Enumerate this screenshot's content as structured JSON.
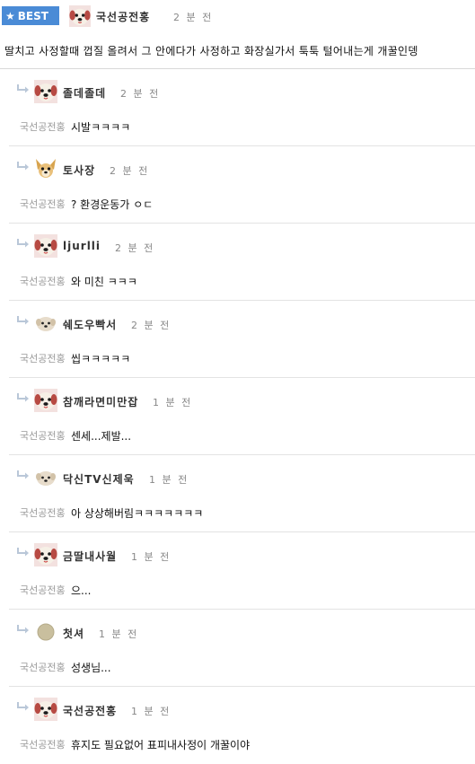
{
  "post": {
    "badge_label": "BEST",
    "author": "국선공전홍",
    "time": "2 분 전",
    "text": "딸치고 사정할때 껍질 올려서 그 안에다가 사정하고 화장실가서 툭툭 털어내는게 개꿀인뎅"
  },
  "replies": [
    {
      "author": "졸데졸데",
      "time": "2 분 전",
      "quote": "국선공전홍",
      "text": "시발ㅋㅋㅋㅋ",
      "avatar": "dog-avatar"
    },
    {
      "author": "토사장",
      "time": "2 분 전",
      "quote": "국선공전홍",
      "text": "? 환경운동가 ㅇㄷ",
      "avatar": "chihuahua-avatar"
    },
    {
      "author": "ljurlli",
      "time": "2 분 전",
      "quote": "국선공전홍",
      "text": "와 미친 ㅋㅋㅋ",
      "avatar": "dog-avatar"
    },
    {
      "author": "쉐도우빡서",
      "time": "2 분 전",
      "quote": "국선공전홍",
      "text": "씹ㅋㅋㅋㅋㅋ",
      "avatar": "small-dog-avatar"
    },
    {
      "author": "참깨라면미만잡",
      "time": "1 분 전",
      "quote": "국선공전홍",
      "text": "센세...제발...",
      "avatar": "dog-avatar"
    },
    {
      "author": "닥신TV신제욱",
      "time": "1 분 전",
      "quote": "국선공전홍",
      "text": "아 상상해버림ㅋㅋㅋㅋㅋㅋㅋ",
      "avatar": "small-dog-avatar"
    },
    {
      "author": "금딸내사월",
      "time": "1 분 전",
      "quote": "국선공전홍",
      "text": "으...",
      "avatar": "dog-avatar"
    },
    {
      "author": "첫셔",
      "time": "1 분 전",
      "quote": "국선공전홍",
      "text": "성생님...",
      "avatar": "circle-avatar"
    },
    {
      "author": "국선공전홍",
      "time": "1 분 전",
      "quote": "국선공전홍",
      "text": "휴지도 필요없어 표피내사정이 개꿀이야",
      "avatar": "dog-avatar"
    }
  ]
}
